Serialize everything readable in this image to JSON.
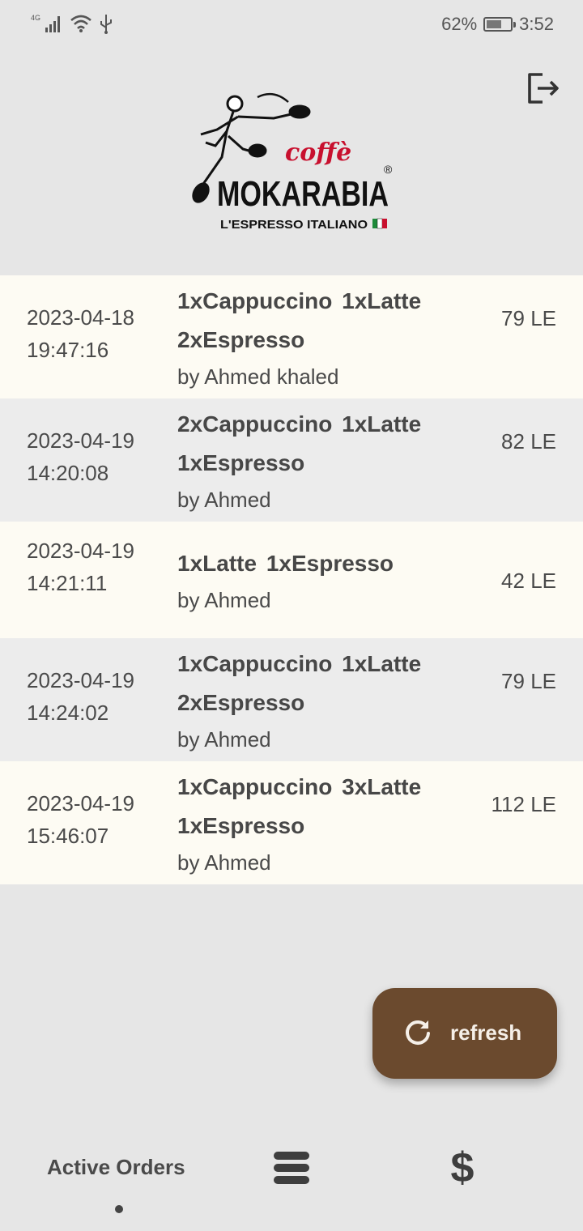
{
  "status_bar": {
    "network": "4G",
    "battery": "62%",
    "battery_level": 0.62,
    "time": "3:52"
  },
  "brand": {
    "script": "coffè",
    "name": "MOKARABIA",
    "registered": "®",
    "tagline": "L'ESPRESSO ITALIANO"
  },
  "orders": [
    {
      "date": "2023-04-18",
      "time": "19:47:16",
      "items_line1": "1xCappuccino  1xLatte",
      "items_line2": "2xEspresso",
      "by": "by Ahmed khaled",
      "price": "79 LE"
    },
    {
      "date": "2023-04-19",
      "time": "14:20:08",
      "items_line1": "2xCappuccino  1xLatte",
      "items_line2": "1xEspresso",
      "by": "by Ahmed",
      "price": "82 LE"
    },
    {
      "date": "2023-04-19",
      "time": "14:21:11",
      "items_line1": "1xLatte  1xEspresso",
      "items_line2": "",
      "by": "by Ahmed",
      "price": "42 LE"
    },
    {
      "date": "2023-04-19",
      "time": "14:24:02",
      "items_line1": "1xCappuccino  1xLatte",
      "items_line2": "2xEspresso",
      "by": "by Ahmed",
      "price": "79 LE"
    },
    {
      "date": "2023-04-19",
      "time": "15:46:07",
      "items_line1": "1xCappuccino  3xLatte",
      "items_line2": "1xEspresso",
      "by": "by Ahmed",
      "price": "112 LE"
    }
  ],
  "fab": {
    "label": "refresh",
    "icon": "refresh-icon"
  },
  "bottom_nav": {
    "active_label": "Active Orders",
    "menu_icon": "menu-icon",
    "dollar_icon": "$"
  },
  "colors": {
    "background": "#e6e6e6",
    "row_light": "#fdfbf3",
    "row_gray": "#ececec",
    "accent": "#6b4a2e",
    "logo_red": "#c8102e"
  }
}
